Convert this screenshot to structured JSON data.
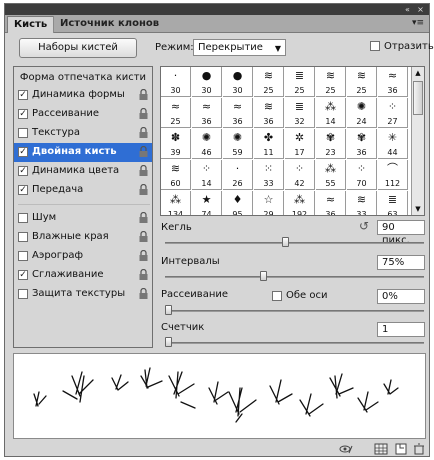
{
  "tabs": [
    {
      "label": "Кисть"
    },
    {
      "label": "Источник клонов"
    }
  ],
  "top_controls": {
    "collapse": "◀◀",
    "close": "✕",
    "menu": "▾≡"
  },
  "brush_presets_button": "Наборы кистей",
  "mode": {
    "label": "Режим:",
    "value": "Перекрытие"
  },
  "flip": {
    "label": "Отразить",
    "checked": false
  },
  "left_list": {
    "header": "Форма отпечатка кисти",
    "items": [
      {
        "label": "Динамика формы",
        "checked": true,
        "selected": false
      },
      {
        "label": "Рассеивание",
        "checked": true,
        "selected": false
      },
      {
        "label": "Текстура",
        "checked": false,
        "selected": false
      },
      {
        "label": "Двойная кисть",
        "checked": true,
        "selected": true
      },
      {
        "label": "Динамика цвета",
        "checked": true,
        "selected": false
      },
      {
        "label": "Передача",
        "checked": true,
        "selected": false
      },
      {
        "label": "Шум",
        "checked": false,
        "selected": false
      },
      {
        "label": "Влажные края",
        "checked": false,
        "selected": false
      },
      {
        "label": "Аэрограф",
        "checked": false,
        "selected": false
      },
      {
        "label": "Сглаживание",
        "checked": true,
        "selected": false
      },
      {
        "label": "Защита текстуры",
        "checked": false,
        "selected": false
      }
    ]
  },
  "brush_grid": {
    "rows": [
      [
        {
          "num": "30",
          "icon": "·"
        },
        {
          "num": "30",
          "icon": "●"
        },
        {
          "num": "30",
          "icon": "●"
        },
        {
          "num": "25",
          "icon": "≋"
        },
        {
          "num": "25",
          "icon": "≣"
        },
        {
          "num": "25",
          "icon": "≋"
        },
        {
          "num": "25",
          "icon": "≋"
        },
        {
          "num": "36",
          "icon": "≈"
        }
      ],
      [
        {
          "num": "25",
          "icon": "≈"
        },
        {
          "num": "36",
          "icon": "≈"
        },
        {
          "num": "36",
          "icon": "≈"
        },
        {
          "num": "36",
          "icon": "≋"
        },
        {
          "num": "32",
          "icon": "≣"
        },
        {
          "num": "14",
          "icon": "⁂"
        },
        {
          "num": "24",
          "icon": "✺"
        },
        {
          "num": "27",
          "icon": "⁘"
        }
      ],
      [
        {
          "num": "39",
          "icon": "✽"
        },
        {
          "num": "46",
          "icon": "✺"
        },
        {
          "num": "59",
          "icon": "✺"
        },
        {
          "num": "11",
          "icon": "✤"
        },
        {
          "num": "17",
          "icon": "✲"
        },
        {
          "num": "23",
          "icon": "✾"
        },
        {
          "num": "36",
          "icon": "✾"
        },
        {
          "num": "44",
          "icon": "✳"
        }
      ],
      [
        {
          "num": "60",
          "icon": "≋"
        },
        {
          "num": "14",
          "icon": "⁘"
        },
        {
          "num": "26",
          "icon": "·"
        },
        {
          "num": "33",
          "icon": "⁙"
        },
        {
          "num": "42",
          "icon": "⁘"
        },
        {
          "num": "55",
          "icon": "⁂"
        },
        {
          "num": "70",
          "icon": "⁘"
        },
        {
          "num": "112",
          "icon": "⌒"
        }
      ],
      [
        {
          "num": "134",
          "icon": "⁂"
        },
        {
          "num": "74",
          "icon": "★"
        },
        {
          "num": "95",
          "icon": "♦"
        },
        {
          "num": "29",
          "icon": "☆"
        },
        {
          "num": "192",
          "icon": "⁂"
        },
        {
          "num": "36",
          "icon": "≈"
        },
        {
          "num": "33",
          "icon": "≋"
        },
        {
          "num": "63",
          "icon": "≣"
        }
      ]
    ]
  },
  "size": {
    "label": "Кегль",
    "value": "90 пикс.",
    "level": 0.47
  },
  "spacing": {
    "label": "Интервалы",
    "value": "75%",
    "level": 0.38
  },
  "scatter": {
    "label": "Рассеивание",
    "both_axes_label": "Обе оси",
    "both_axes_checked": false,
    "value": "0%",
    "level": 0
  },
  "count": {
    "label": "Счетчик",
    "value": "1",
    "level": 0
  },
  "bottom_icons": [
    "eye-brush-icon",
    "grid-icon",
    "new-preset-icon",
    "trash-icon"
  ]
}
